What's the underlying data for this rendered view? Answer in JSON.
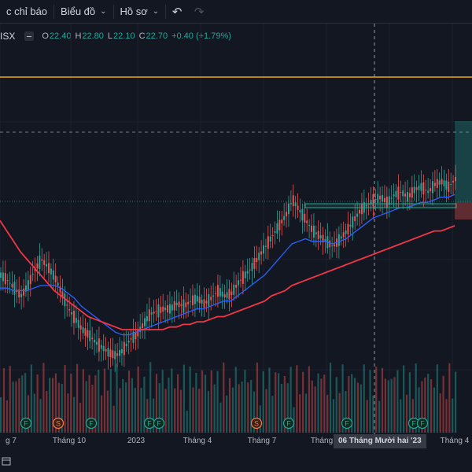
{
  "toolbar": {
    "indicators_label": "c chỉ báo",
    "chart_label": "Biểu đồ",
    "profile_label": "Hồ sơ",
    "undo_icon": "undo-icon",
    "redo_icon": "redo-icon"
  },
  "legend": {
    "symbol": "ISX",
    "open_key": "O",
    "open": "22.40",
    "high_key": "H",
    "high": "22.80",
    "low_key": "L",
    "low": "22.10",
    "close_key": "C",
    "close": "22.70",
    "change": "+0.40 (+1.79%)"
  },
  "crosshair": {
    "date_label": "06 Tháng Mười hai '23"
  },
  "colors": {
    "background": "#131722",
    "up": "#26a69a",
    "down": "#ef5350",
    "ma_fast": "#2962ff",
    "ma_slow": "#f23645",
    "horizontal_line": "#f0a818"
  },
  "chart_data": {
    "type": "line",
    "x_ticks": [
      "g 7",
      "Tháng 10",
      "2023",
      "Tháng 4",
      "Tháng 7",
      "Tháng",
      "Tháng 4"
    ],
    "event_markers": [
      {
        "label": "F",
        "kind": "financial"
      },
      {
        "label": "S",
        "kind": "split"
      },
      {
        "label": "F",
        "kind": "financial"
      },
      {
        "label": "F",
        "kind": "financial"
      },
      {
        "label": "F",
        "kind": "financial"
      },
      {
        "label": "S",
        "kind": "split"
      },
      {
        "label": "F",
        "kind": "financial"
      },
      {
        "label": "F",
        "kind": "financial"
      },
      {
        "label": "F",
        "kind": "financial"
      },
      {
        "label": "F",
        "kind": "financial"
      }
    ],
    "series": [
      {
        "values": [
          41,
          39,
          36,
          33,
          37,
          43,
          47,
          44,
          40,
          34,
          28,
          24,
          20,
          18,
          15,
          13,
          11,
          10,
          12,
          16,
          18,
          22,
          26,
          27,
          28,
          28,
          30,
          29,
          31,
          32,
          30,
          32,
          35,
          33,
          34,
          38,
          41,
          44,
          48,
          52,
          56,
          60,
          64,
          70,
          66,
          62,
          58,
          56,
          54,
          52,
          55,
          58,
          62,
          66,
          68,
          70,
          71,
          69,
          72,
          73,
          71,
          74,
          75,
          73,
          76,
          77,
          75,
          78
        ]
      },
      {
        "values": [
          36,
          36,
          35,
          35,
          35,
          36,
          37,
          37,
          37,
          36,
          34,
          32,
          29,
          27,
          25,
          23,
          21,
          19,
          18,
          18,
          19,
          20,
          21,
          22,
          23,
          24,
          25,
          26,
          27,
          28,
          28,
          29,
          30,
          31,
          31,
          33,
          35,
          37,
          39,
          41,
          44,
          47,
          50,
          53,
          54,
          55,
          54,
          54,
          54,
          53,
          54,
          55,
          57,
          59,
          61,
          63,
          64,
          65,
          66,
          67,
          67,
          68,
          69,
          69,
          70,
          71,
          71,
          72
        ]
      },
      {
        "values": [
          62,
          58,
          54,
          50,
          47,
          44,
          41,
          38,
          35,
          33,
          31,
          29,
          27,
          25,
          24,
          23,
          22,
          21,
          20,
          20,
          20,
          20,
          20,
          20,
          20,
          21,
          21,
          22,
          22,
          23,
          23,
          24,
          25,
          25,
          26,
          27,
          28,
          29,
          30,
          31,
          33,
          34,
          35,
          37,
          38,
          39,
          40,
          41,
          42,
          43,
          44,
          45,
          46,
          47,
          48,
          49,
          50,
          51,
          52,
          53,
          54,
          55,
          56,
          57,
          58,
          58,
          59,
          60
        ]
      }
    ]
  }
}
